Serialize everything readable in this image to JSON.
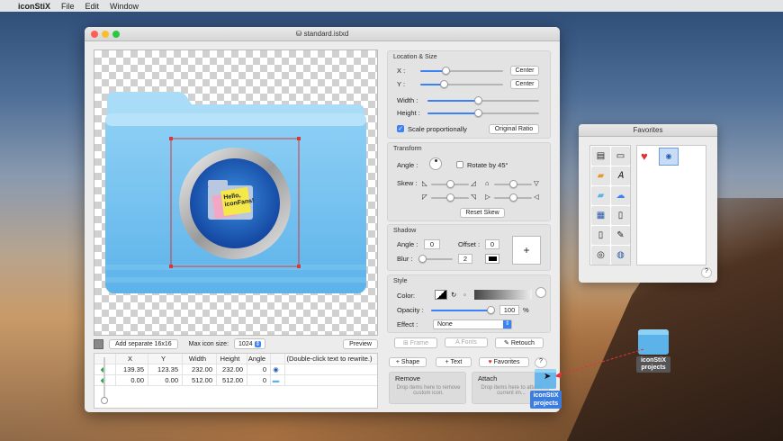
{
  "menubar": {
    "apple": "",
    "app": "iconStiX",
    "items": [
      "File",
      "Edit",
      "Window"
    ]
  },
  "window": {
    "title": "standard.istxd"
  },
  "canvas": {
    "sticky_note": "Hello,\niconFans!"
  },
  "bottombar": {
    "add_separate": "Add separate 16x16",
    "max_icon_size_label": "Max icon size:",
    "max_icon_size_value": "1024",
    "preview": "Preview"
  },
  "table": {
    "headers": [
      "X",
      "Y",
      "Width",
      "Height",
      "Angle",
      "",
      "(Double-click text to rewrite.)"
    ],
    "rows": [
      {
        "x": "139.35",
        "y": "123.35",
        "width": "232.00",
        "height": "232.00",
        "angle": "0"
      },
      {
        "x": "0.00",
        "y": "0.00",
        "width": "512.00",
        "height": "512.00",
        "angle": "0"
      }
    ]
  },
  "location_size": {
    "title": "Location & Size",
    "x_label": "X :",
    "y_label": "Y :",
    "width_label": "Width :",
    "height_label": "Height :",
    "center": "Center",
    "scale_label": "Scale proportionally",
    "original_ratio": "Original Ratio",
    "x_level": 0.3,
    "y_level": 0.28,
    "width_level": 0.45,
    "height_level": 0.45
  },
  "transform": {
    "title": "Transform",
    "angle_label": "Angle :",
    "rotate_label": "Rotate by 45°",
    "skew_label": "Skew :",
    "reset_skew": "Reset Skew"
  },
  "shadow": {
    "title": "Shadow",
    "angle_label": "Angle :",
    "angle_value": "0",
    "offset_label": "Offset :",
    "offset_value": "0",
    "blur_label": "Blur :",
    "blur_value": "2",
    "add": "+"
  },
  "style": {
    "title": "Style",
    "color_label": "Color:",
    "opacity_label": "Opacity :",
    "opacity_value": "100",
    "opacity_unit": "%",
    "effect_label": "Effect :",
    "effect_value": "None",
    "frame": "Frame",
    "fonts": "Fonts",
    "retouch": "Retouch"
  },
  "actions": {
    "shape": "Shape",
    "text": "Text",
    "favorites": "Favorites",
    "help": "?"
  },
  "remove": {
    "title": "Remove",
    "hint": "Drop items here to remove custom icon."
  },
  "attach": {
    "title": "Attach",
    "hint": "Drop items here to attach current im..."
  },
  "favorites_window": {
    "title": "Favorites",
    "help": "?"
  },
  "desktop_icon": {
    "label": "iconStiX projects"
  },
  "drag_tag": {
    "label": "iconStiX projects"
  }
}
